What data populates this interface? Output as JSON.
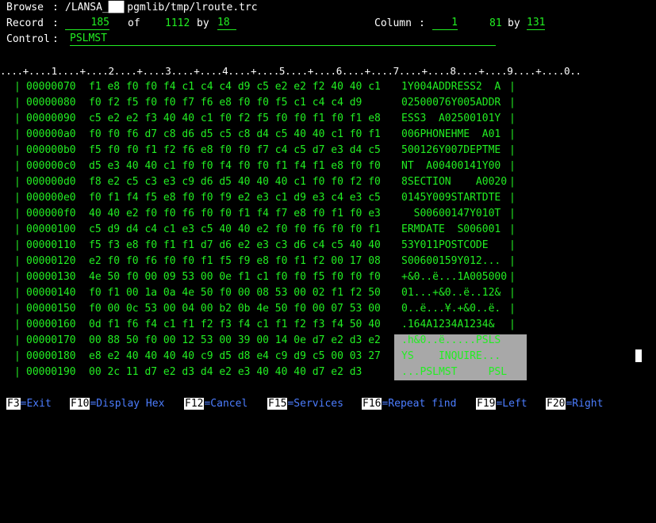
{
  "header": {
    "browse_label": "Browse",
    "browse_colon": ":",
    "path": "/LANSA_██▌pgmlib/tmp/lroute.trc",
    "record_label": "Record",
    "record_colon": ":",
    "record_value": "185",
    "of_label": "of",
    "total_records": "1112",
    "by_label": "by",
    "record_width": "18",
    "column_label": "Column",
    "column_colon": ":",
    "column_value": "1",
    "column_range": "81",
    "column_by": "by",
    "column_total": "131",
    "control_label": "Control",
    "control_colon": ":",
    "control_value": "PSLMST"
  },
  "ruler": "....+....1....+....2....+....3....+....4....+....5....+....6....+....7....+....8....+....9....+....0..",
  "rows": [
    {
      "addr": "00000070",
      "hex": "f1 e8 f0 f0 f4 c1 c4 c4 d9 c5 e2 e2 f2 40 40 c1",
      "text": "1Y004ADDRESS2  A"
    },
    {
      "addr": "00000080",
      "hex": "f0 f2 f5 f0 f0 f7 f6 e8 f0 f0 f5 c1 c4 c4 d9",
      "text": "02500076Y005ADDR"
    },
    {
      "addr": "00000090",
      "hex": "c5 e2 e2 f3 40 40 c1 f0 f2 f5 f0 f0 f1 f0 f1 e8",
      "text": "ESS3  A02500101Y"
    },
    {
      "addr": "000000a0",
      "hex": "f0 f0 f6 d7 c8 d6 d5 c5 c8 d4 c5 40 40 c1 f0 f1",
      "text": "006PHONEHME  A01"
    },
    {
      "addr": "000000b0",
      "hex": "f5 f0 f0 f1 f2 f6 e8 f0 f0 f7 c4 c5 d7 e3 d4 c5",
      "text": "500126Y007DEPTME"
    },
    {
      "addr": "000000c0",
      "hex": "d5 e3 40 40 c1 f0 f0 f4 f0 f0 f1 f4 f1 e8 f0 f0",
      "text": "NT  A00400141Y00"
    },
    {
      "addr": "000000d0",
      "hex": "f8 e2 c5 c3 e3 c9 d6 d5 40 40 40 c1 f0 f0 f2 f0",
      "text": "8SECTION    A0020"
    },
    {
      "addr": "000000e0",
      "hex": "f0 f1 f4 f5 e8 f0 f0 f9 e2 e3 c1 d9 e3 c4 e3 c5",
      "text": "0145Y009STARTDTE"
    },
    {
      "addr": "000000f0",
      "hex": "40 40 e2 f0 f0 f6 f0 f0 f1 f4 f7 e8 f0 f1 f0 e3",
      "text": "  S00600147Y010T"
    },
    {
      "addr": "00000100",
      "hex": "c5 d9 d4 c4 c1 e3 c5 40 40 e2 f0 f0 f6 f0 f0 f1",
      "text": "ERMDATE  S006001"
    },
    {
      "addr": "00000110",
      "hex": "f5 f3 e8 f0 f1 f1 d7 d6 e2 e3 c3 d6 c4 c5 40 40",
      "text": "53Y011POSTCODE"
    },
    {
      "addr": "00000120",
      "hex": "e2 f0 f0 f6 f0 f0 f1 f5 f9 e8 f0 f1 f2 00 17 08",
      "text": "S00600159Y012..."
    },
    {
      "addr": "00000130",
      "hex": "4e 50 f0 00 09 53 00 0e f1 c1 f0 f0 f5 f0 f0 f0",
      "text": "+&0..ë...1A005000"
    },
    {
      "addr": "00000140",
      "hex": "f0 f1 00 1a 0a 4e 50 f0 00 08 53 00 02 f1 f2 50",
      "text": "01...+&0..ë..12&"
    },
    {
      "addr": "00000150",
      "hex": "f0 00 0c 53 00 04 00 b2 0b 4e 50 f0 00 07 53 00",
      "text": "0..ë...¥.+&0..ë."
    },
    {
      "addr": "00000160",
      "hex": "0d f1 f6 f4 c1 f1 f2 f3 f4 c1 f1 f2 f3 f4 50 40",
      "text": ".164A1234A1234&"
    },
    {
      "addr": "00000170",
      "hex": "00 88 50 f0 00 12 53 00 39 00 14 0e d7 e2 d3 e2",
      "text": ".h&0..ë.....PSLS"
    },
    {
      "addr": "00000180",
      "hex": "e8 e2 40 40 40 40 c9 d5 d8 e4 c9 d9 c5 00 03 27",
      "text": "YS    INQUIRE..."
    },
    {
      "addr": "00000190",
      "hex": "00 2c 11 d7 e2 d3 d4 e2 e3 40 40 40 d7 e2 d3",
      "text": "...PSLMST     PSL"
    }
  ],
  "fkeys": [
    {
      "key": "F3",
      "label": "=Exit"
    },
    {
      "key": "F10",
      "label": "=Display Hex"
    },
    {
      "key": "F12",
      "label": "=Cancel"
    },
    {
      "key": "F15",
      "label": "=Services"
    },
    {
      "key": "F16",
      "label": "=Repeat find"
    },
    {
      "key": "F19",
      "label": "=Left"
    },
    {
      "key": "F20",
      "label": "=Right"
    }
  ],
  "colors": {
    "text_green": "#22ee22",
    "label_white": "#ffffff",
    "fkey_blue": "#4c7dff",
    "selection_gray": "#a8a8a8",
    "background": "#000000"
  }
}
